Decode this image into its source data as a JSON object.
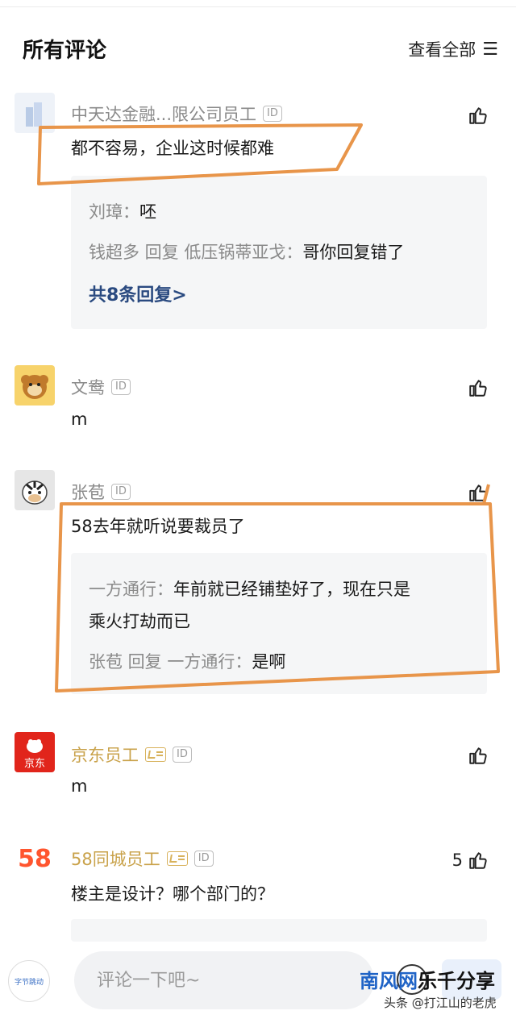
{
  "header": {
    "title": "所有评论",
    "view_all": "查看全部",
    "menu_icon": "list-menu-icon"
  },
  "comments": [
    {
      "user": "中天达金融...限公司员工",
      "id_badge": "ID",
      "text": "都不容易，企业这时候都难",
      "likes": "",
      "replies": [
        {
          "name": "刘璋：",
          "text": "呸"
        },
        {
          "name": "钱超多 回复 低压锅蒂亚戈：",
          "text": "哥你回复错了"
        }
      ],
      "more": "共8条回复>"
    },
    {
      "user": "文鸯",
      "id_badge": "ID",
      "text": "m",
      "likes": ""
    },
    {
      "user": "张苞",
      "id_badge": "ID",
      "text": "58去年就听说要裁员了",
      "likes": "",
      "replies": [
        {
          "name": "一方通行：",
          "text": "年前就已经铺垫好了，现在只是"
        },
        {
          "name": "",
          "text": "乘火打劫而已"
        },
        {
          "name": "张苞 回复 一方通行：",
          "text": "是啊"
        }
      ]
    },
    {
      "user": "京东员工",
      "id_badge": "ID",
      "text": "m",
      "likes": "",
      "avatar_text": "京东"
    },
    {
      "user": "58同城员工",
      "id_badge": "ID",
      "text": "楼主是设计？哪个部门的？",
      "likes": "5",
      "avatar_text": "58"
    }
  ],
  "bottom": {
    "placeholder": "评论一下吧~",
    "my_avatar_text": "字节跳动",
    "watermark_main_blue": "南风网",
    "watermark_main_black": "乐千分享",
    "watermark_sub": "头条 @打江山的老虎"
  },
  "colors": {
    "annotation": "#e8954a",
    "link": "#2a4a80",
    "gold_name": "#c9a24a"
  }
}
